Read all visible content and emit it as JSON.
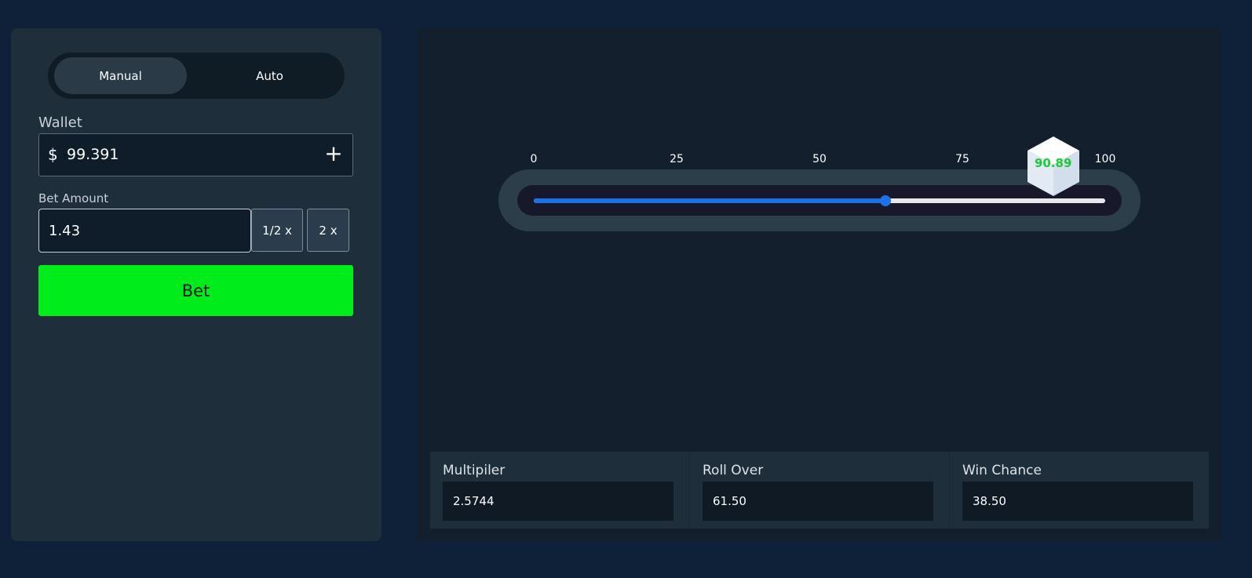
{
  "mode": {
    "manual": "Manual",
    "auto": "Auto",
    "active": "manual"
  },
  "wallet": {
    "label": "Wallet",
    "currency": "$",
    "value": "99.391",
    "add_icon": "plus-icon"
  },
  "bet": {
    "label": "Bet Amount",
    "value": "1.43",
    "half_label": "1/2 x",
    "double_label": "2 x",
    "button_label": "Bet"
  },
  "slider": {
    "ticks": [
      "0",
      "25",
      "50",
      "75",
      "100"
    ],
    "min": 0,
    "max": 100,
    "value": 61.5,
    "fill_color": "#1a74e8"
  },
  "result": {
    "value": "90.89",
    "numeric": 90.89,
    "color": "#1fc93a"
  },
  "stats": {
    "multiplier_label": "Multipiler",
    "multiplier_value": "2.5744",
    "roll_over_label": "Roll Over",
    "roll_over_value": "61.50",
    "win_chance_label": "Win Chance",
    "win_chance_value": "38.50"
  },
  "colors": {
    "bet_button": "#00ec1b",
    "background": "#0f2138",
    "panel": "#1f2e3b"
  }
}
